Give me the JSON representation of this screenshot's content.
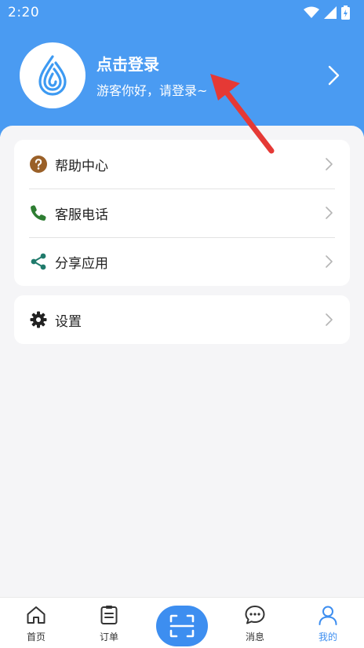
{
  "status_bar": {
    "time": "2:20"
  },
  "profile": {
    "title": "点击登录",
    "subtitle": "游客你好，请登录~"
  },
  "menu": {
    "group1": [
      {
        "label": "帮助中心",
        "icon": "help-icon",
        "color": "#9a6028"
      },
      {
        "label": "客服电话",
        "icon": "phone-icon",
        "color": "#2e7d32"
      },
      {
        "label": "分享应用",
        "icon": "share-icon",
        "color": "#1f7a6b"
      }
    ],
    "group2": [
      {
        "label": "设置",
        "icon": "gear-icon",
        "color": "#222222"
      }
    ]
  },
  "tabbar": {
    "items": [
      {
        "label": "首页",
        "icon": "home-icon",
        "active": false
      },
      {
        "label": "订单",
        "icon": "order-icon",
        "active": false
      },
      {
        "label": "",
        "icon": "scan-icon",
        "active": false
      },
      {
        "label": "消息",
        "icon": "message-icon",
        "active": false
      },
      {
        "label": "我的",
        "icon": "user-icon",
        "active": true
      }
    ]
  },
  "colors": {
    "brand": "#4a9bf2",
    "accent": "#3d8ef0",
    "annotation_arrow": "#e53935"
  }
}
